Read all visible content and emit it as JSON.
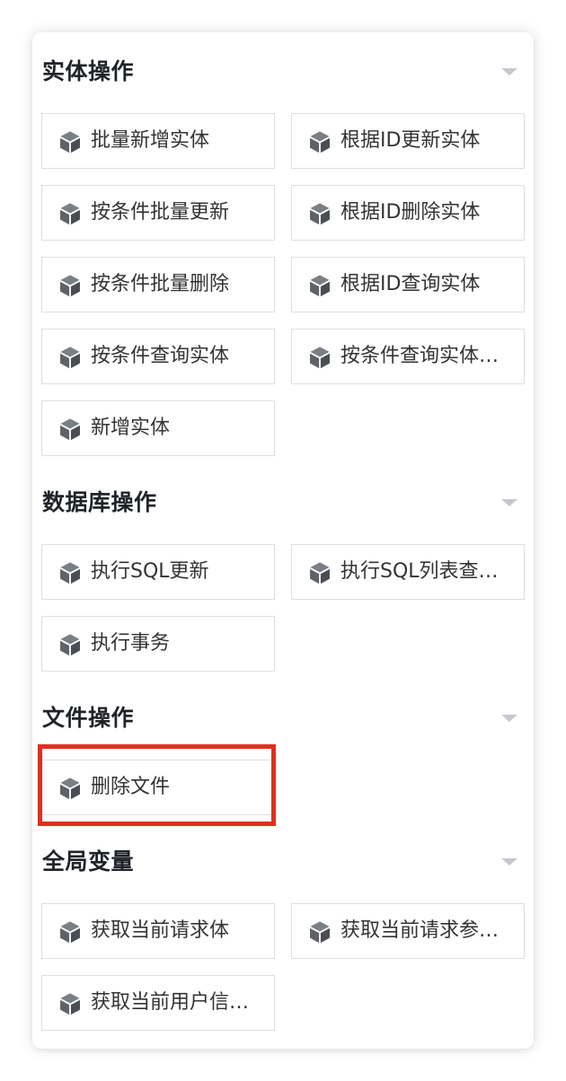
{
  "sections": [
    {
      "title": "实体操作",
      "items": [
        {
          "label": "批量新增实体"
        },
        {
          "label": "根据ID更新实体"
        },
        {
          "label": "按条件批量更新"
        },
        {
          "label": "根据ID删除实体"
        },
        {
          "label": "按条件批量删除"
        },
        {
          "label": "根据ID查询实体"
        },
        {
          "label": "按条件查询实体"
        },
        {
          "label": "按条件查询实体…"
        },
        {
          "label": "新增实体"
        }
      ]
    },
    {
      "title": "数据库操作",
      "items": [
        {
          "label": "执行SQL更新"
        },
        {
          "label": "执行SQL列表查…"
        },
        {
          "label": "执行事务"
        }
      ]
    },
    {
      "title": "文件操作",
      "items": [
        {
          "label": "删除文件"
        }
      ]
    },
    {
      "title": "全局变量",
      "items": [
        {
          "label": "获取当前请求体"
        },
        {
          "label": "获取当前请求参…"
        },
        {
          "label": "获取当前用户信…"
        }
      ]
    }
  ],
  "icon": "cube-icon",
  "colors": {
    "icon": "#5f6368",
    "border": "#dcdfe6",
    "title": "#1f2329",
    "caret": "#c5c8ce",
    "highlight": "#e0301e"
  }
}
